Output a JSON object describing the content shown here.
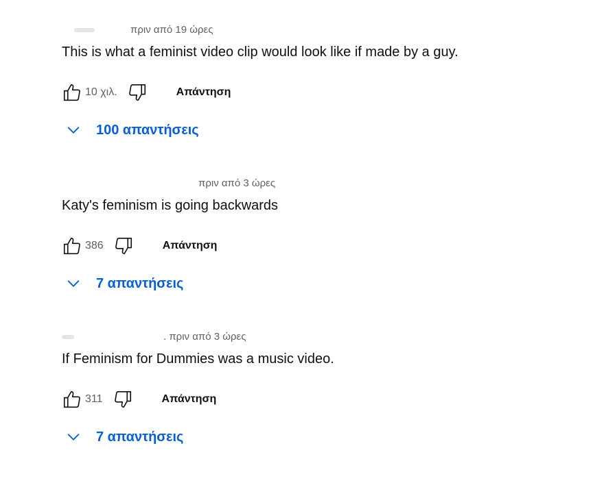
{
  "comments": [
    {
      "timestamp": "πριν από 19 ώρες",
      "text": "This is what a feminist video clip would look like if made by a guy.",
      "likes": "10 χιλ.",
      "reply_label": "Απάντηση",
      "replies_label": "100 απαντήσεις"
    },
    {
      "timestamp": "πριν από 3 ώρες",
      "text": "Katy's feminism is going backwards",
      "likes": "386",
      "reply_label": "Απάντηση",
      "replies_label": "7 απαντήσεις"
    },
    {
      "timestamp": ". πριν από 3 ώρες",
      "text": "If Feminism for Dummies was a music video.",
      "likes": "311",
      "reply_label": "Απάντηση",
      "replies_label": "7 απαντήσεις"
    }
  ],
  "icons": {
    "like": "thumbs-up-icon",
    "dislike": "thumbs-down-icon",
    "expand": "chevron-down-icon"
  },
  "colors": {
    "link_blue": "#065fd4",
    "secondary_text": "#606060",
    "primary_text": "#0f0f0f"
  }
}
